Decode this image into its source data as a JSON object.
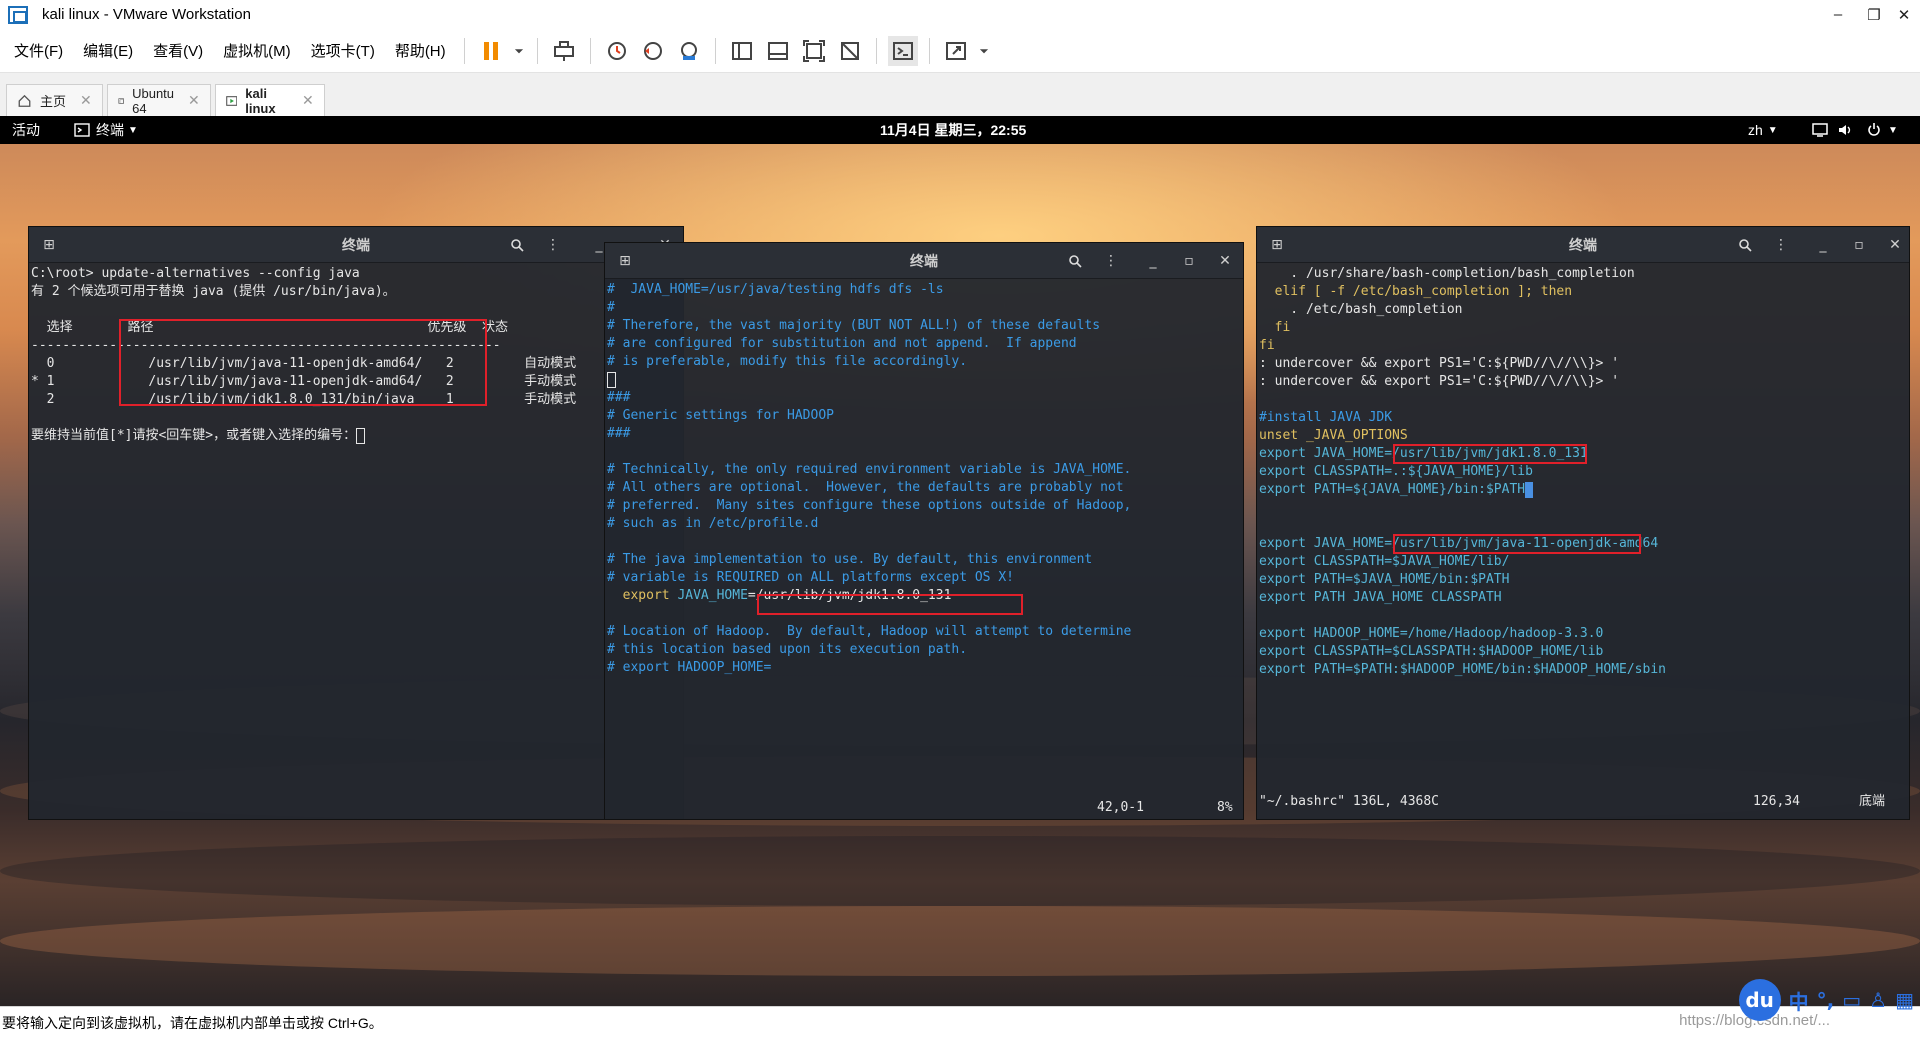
{
  "window": {
    "title": "kali linux - VMware Workstation"
  },
  "menu": [
    "文件(F)",
    "编辑(E)",
    "查看(V)",
    "虚拟机(M)",
    "选项卡(T)",
    "帮助(H)"
  ],
  "tabs": [
    {
      "label": "主页"
    },
    {
      "label": "Ubuntu 64"
    },
    {
      "label": "kali linux"
    }
  ],
  "gnome": {
    "activities": "活动",
    "app": "终端",
    "clock": "11月4日 星期三，22:55",
    "lang": "zh"
  },
  "term1": {
    "title": "终端",
    "lines": [
      "C:\\root> update-alternatives --config java",
      "有 2 个候选项可用于替换 java (提供 /usr/bin/java)。",
      "",
      "  选择       路径                                   优先级  状态",
      "------------------------------------------------------------",
      "  0            /usr/lib/jvm/java-11-openjdk-amd64/   2         自动模式",
      "* 1            /usr/lib/jvm/java-11-openjdk-amd64/   2         手动模式",
      "  2            /usr/lib/jvm/jdk1.8.0_131/bin/java    1         手动模式",
      "",
      "要维持当前值[*]请按<回车键>，或者键入选择的编号："
    ]
  },
  "term2": {
    "title": "终端",
    "lines": [
      "#  JAVA_HOME=/usr/java/testing hdfs dfs -ls",
      "#",
      "# Therefore, the vast majority (BUT NOT ALL!) of these defaults",
      "# are configured for substitution and not append.  If append",
      "# is preferable, modify this file accordingly.",
      "",
      "###",
      "# Generic settings for HADOOP",
      "###",
      "",
      "# Technically, the only required environment variable is JAVA_HOME.",
      "# All others are optional.  However, the defaults are probably not",
      "# preferred.  Many sites configure these options outside of Hadoop,",
      "# such as in /etc/profile.d",
      "",
      "# The java implementation to use. By default, this environment",
      "# variable is REQUIRED on ALL platforms except OS X!",
      "",
      "",
      "# Location of Hadoop.  By default, Hadoop will attempt to determine",
      "# this location based upon its execution path.",
      "# export HADOOP_HOME="
    ],
    "export_prefix": "  export ",
    "export_var": "JAVA_HOME",
    "export_value": "=/usr/lib/jvm/jdk1.8.0_131",
    "pos": "42,0-1",
    "pct": "8%"
  },
  "term3": {
    "title": "终端",
    "lines": [
      "    . /usr/share/bash-completion/bash_completion",
      "  elif [ -f /etc/bash_completion ]; then",
      "    . /etc/bash_completion",
      "  fi",
      "fi",
      ": undercover && export PS1='C:${PWD//\\//\\\\}> '",
      ": undercover && export PS1='C:${PWD//\\//\\\\}> '",
      "",
      "#install JAVA JDK",
      "unset _JAVA_OPTIONS",
      "export JAVA_HOME=/usr/lib/jvm/jdk1.8.0_131",
      "export CLASSPATH=.:${JAVA_HOME}/lib",
      "export PATH=${JAVA_HOME}/bin:$PATH",
      "",
      "",
      "export JAVA_HOME=/usr/lib/jvm/java-11-openjdk-amd64",
      "export CLASSPATH=$JAVA_HOME/lib/",
      "export PATH=$JAVA_HOME/bin:$PATH",
      "export PATH JAVA_HOME CLASSPATH",
      "",
      "export HADOOP_HOME=/home/Hadoop/hadoop-3.3.0",
      "export CLASSPATH=$CLASSPATH:$HADOOP_HOME/lib",
      "export PATH=$PATH:$HADOOP_HOME/bin:$HADOOP_HOME/sbin"
    ],
    "file": "\"~/.bashrc\" 136L, 4368C",
    "pos": "126,34",
    "where": "底端"
  },
  "statusbar": {
    "message": "要将输入定向到该虚拟机，请在虚拟机内部单击或按 Ctrl+G。"
  },
  "tray": {
    "ime": "中"
  },
  "watermark": "https://blog.csdn.net/..."
}
